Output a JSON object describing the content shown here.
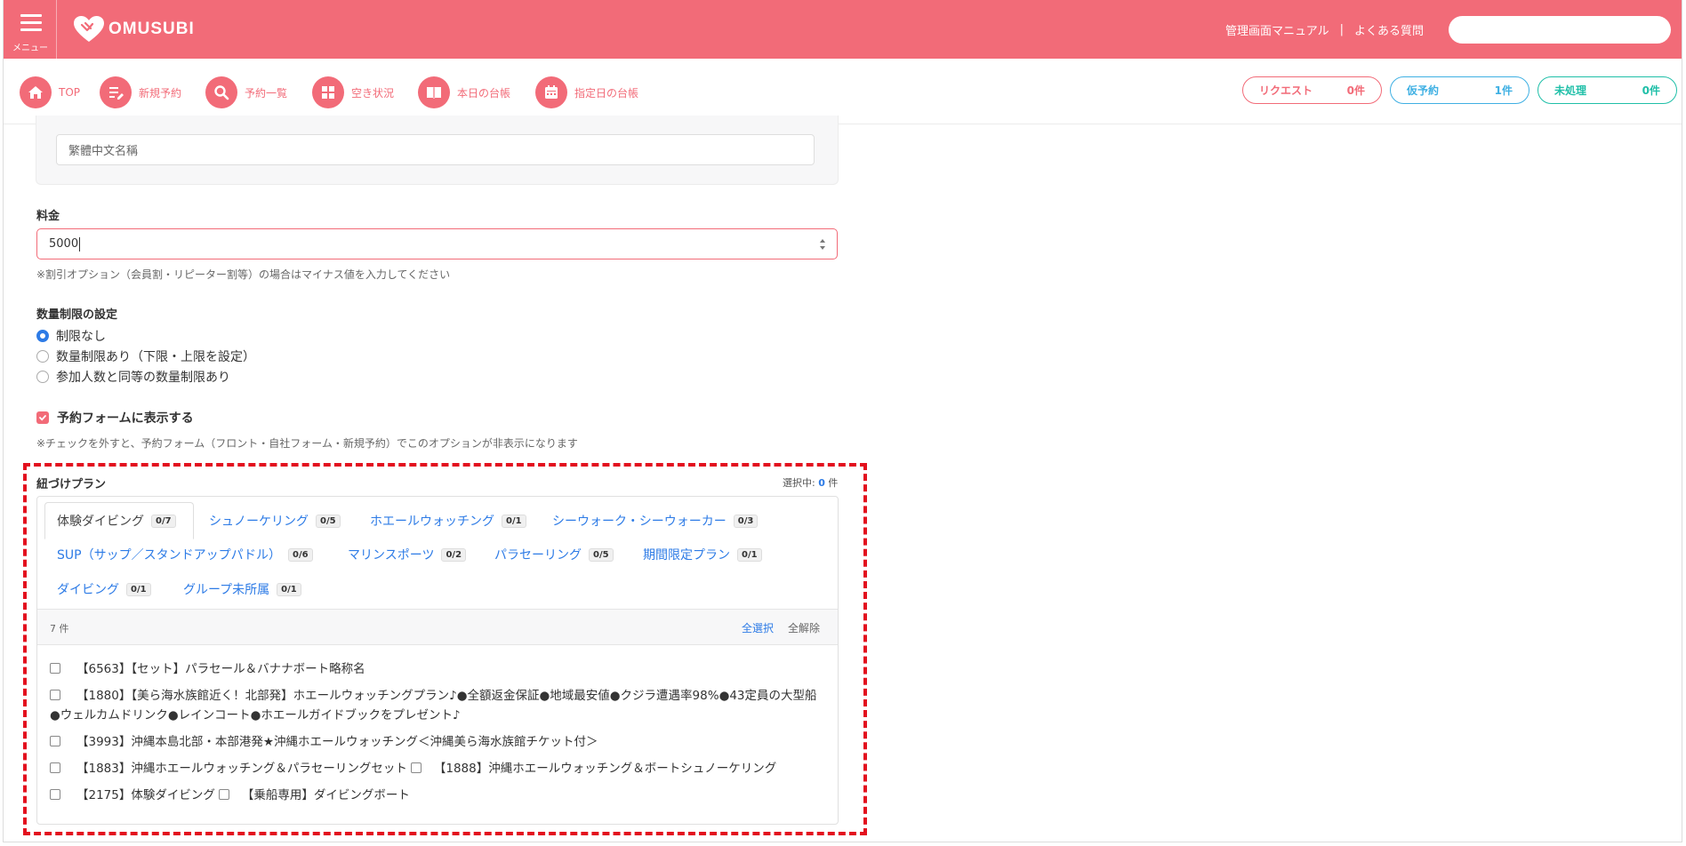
{
  "header": {
    "menu_label": "メニュー",
    "logo_text": "OMUSUBI",
    "links": [
      "管理画面マニュアル",
      "よくある質問"
    ],
    "link_separator": "|",
    "search_placeholder": "",
    "brand_color": "#f26b78"
  },
  "nav": {
    "items": [
      {
        "label": "TOP",
        "icon": "home-icon"
      },
      {
        "label": "新規予約",
        "icon": "edit-list-icon"
      },
      {
        "label": "予約一覧",
        "icon": "search-icon"
      },
      {
        "label": "空き状況",
        "icon": "grid-icon"
      },
      {
        "label": "本日の台帳",
        "icon": "book-icon"
      },
      {
        "label": "指定日の台帳",
        "icon": "calendar-icon"
      }
    ],
    "status": [
      {
        "label": "リクエスト",
        "value": "0件",
        "color": "#f26b78"
      },
      {
        "label": "仮予約",
        "value": "1件",
        "color": "#3fb0e3"
      },
      {
        "label": "未処理",
        "value": "0件",
        "color": "#1fbfa8"
      }
    ]
  },
  "form": {
    "chinese_name_value": "繁體中文名稱",
    "price_label": "料金",
    "price_value": "5000",
    "price_help": "※割引オプション（会員割・リピーター割等）の場合はマイナス値を入力してください",
    "qty_label": "数量制限の設定",
    "qty_options": [
      {
        "label": "制限なし",
        "selected": true
      },
      {
        "label": "数量制限あり（下限・上限を設定）",
        "selected": false
      },
      {
        "label": "参加人数と同等の数量制限あり",
        "selected": false
      }
    ],
    "show_on_form_label": "予約フォームに表示する",
    "show_on_form_checked": true,
    "show_on_form_help": "※チェックを外すと、予約フォーム（フロント・自社フォーム・新規予約）でこのオプションが非表示になります"
  },
  "plans": {
    "title": "紐づけプラン",
    "selected_prefix": "選択中: ",
    "selected_count": "0",
    "selected_suffix": " 件",
    "tabs": [
      {
        "label": "体験ダイビング",
        "count": "0/7"
      },
      {
        "label": "シュノーケリング",
        "count": "0/5"
      },
      {
        "label": "ホエールウォッチング",
        "count": "0/1"
      },
      {
        "label": "シーウォーク・シーウォーカー",
        "count": "0/3"
      },
      {
        "label": "SUP（サップ／スタンドアップパドル）",
        "count": "0/6"
      },
      {
        "label": "マリンスポーツ",
        "count": "0/2"
      },
      {
        "label": "パラセーリング",
        "count": "0/5"
      },
      {
        "label": "期間限定プラン",
        "count": "0/1"
      },
      {
        "label": "ダイビング",
        "count": "0/1"
      },
      {
        "label": "グループ未所属",
        "count": "0/1"
      }
    ],
    "list_count": "7 件",
    "select_all": "全選択",
    "deselect_all": "全解除",
    "items": [
      "【6563】【セット】パラセール＆バナナボート略称名",
      "【1880】【美ら海水族館近く！北部発】ホエールウォッチングプラン♪●全額返金保証●地域最安値●クジラ遭遇率98%●43定員の大型船●ウェルカムドリンク●レインコート●ホエールガイドブックをプレゼント♪",
      "【3993】沖縄本島北部・本部港発★沖縄ホエールウォッチング＜沖縄美ら海水族館チケット付＞",
      "【1883】沖縄ホエールウォッチング＆パラセーリングセット",
      "【1888】沖縄ホエールウォッチング＆ボートシュノーケリング",
      "【2175】体験ダイビング",
      "【乗船専用】ダイビングボート"
    ]
  }
}
